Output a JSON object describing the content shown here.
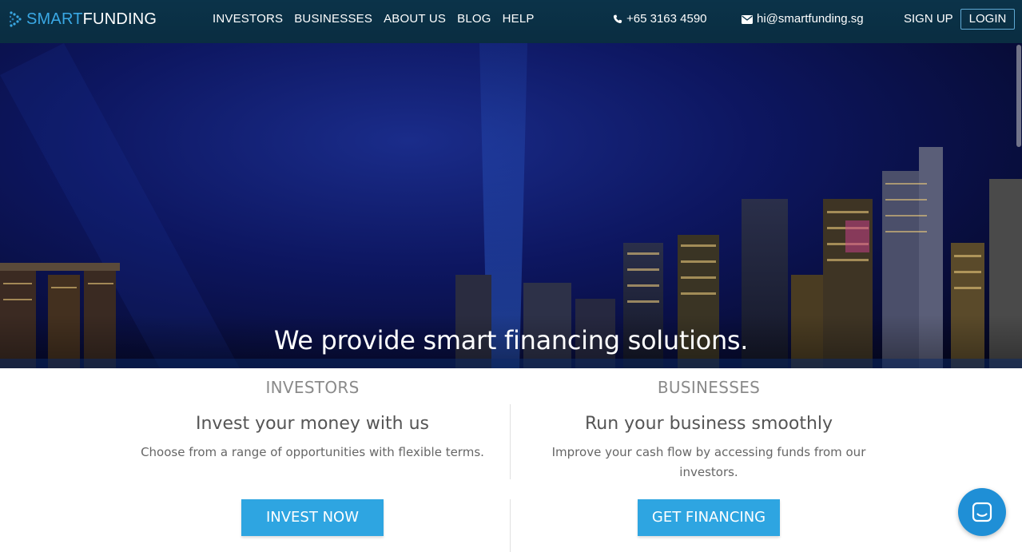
{
  "brand": {
    "smart": "SMART",
    "funding": "FUNDING"
  },
  "nav": {
    "links": [
      "INVESTORS",
      "BUSINESSES",
      "ABOUT US",
      "BLOG",
      "HELP"
    ],
    "phone": "+65 3163 4590",
    "email": "hi@smartfunding.sg",
    "signup": "SIGN UP",
    "login": "LOGIN"
  },
  "hero": {
    "title": "We provide smart financing solutions."
  },
  "investors": {
    "heading": "INVESTORS",
    "subheading": "Invest your money with us",
    "description": "Choose from a range of opportunities with flexible terms.",
    "cta": "INVEST NOW"
  },
  "businesses": {
    "heading": "BUSINESSES",
    "subheading": "Run your business smoothly",
    "description": "Improve your cash flow by accessing funds from our investors.",
    "cta": "GET FINANCING"
  },
  "colors": {
    "accent": "#2ea5e1",
    "navbar": "#0b3349",
    "chat": "#1f8fd6"
  },
  "icons": {
    "phone": "phone-icon",
    "email": "envelope-icon",
    "chat": "chat-icon"
  }
}
